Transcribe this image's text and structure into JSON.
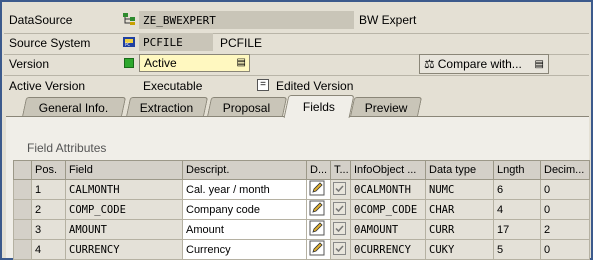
{
  "header": {
    "datasource": {
      "label": "DataSource",
      "value": "ZE_BWEXPERT",
      "description": "BW Expert"
    },
    "source_system": {
      "label": "Source System",
      "value": "PCFILE",
      "description": "PCFILE"
    },
    "version": {
      "label": "Version",
      "value": "Active"
    },
    "active_version": {
      "label": "Active Version",
      "value": "Executable",
      "edited_label": "Edited Version"
    },
    "compare_button": {
      "label": "Compare with..."
    }
  },
  "tabs": [
    {
      "label": "General Info."
    },
    {
      "label": "Extraction"
    },
    {
      "label": "Proposal"
    },
    {
      "label": "Fields",
      "active": true
    },
    {
      "label": "Preview"
    }
  ],
  "field_attributes": {
    "title": "Field Attributes",
    "columns": [
      "Pos.",
      "Field",
      "Descript.",
      "D...",
      "T...",
      "InfoObject ...",
      "Data type",
      "Lngth",
      "Decim..."
    ],
    "rows": [
      {
        "pos": "1",
        "field": "CALMONTH",
        "descript": "Cal. year / month",
        "infoobject": "0CALMONTH",
        "datatype": "NUMC",
        "length": "6",
        "decimals": "0"
      },
      {
        "pos": "2",
        "field": "COMP_CODE",
        "descript": "Company code",
        "infoobject": "0COMP_CODE",
        "datatype": "CHAR",
        "length": "4",
        "decimals": "0"
      },
      {
        "pos": "3",
        "field": "AMOUNT",
        "descript": "Amount",
        "infoobject": "0AMOUNT",
        "datatype": "CURR",
        "length": "17",
        "decimals": "2"
      },
      {
        "pos": "4",
        "field": "CURRENCY",
        "descript": "Currency",
        "infoobject": "0CURRENCY",
        "datatype": "CUKY",
        "length": "5",
        "decimals": "0"
      }
    ]
  },
  "colors": {
    "frame": "#3c5a8c",
    "version_field": "#fff8c0",
    "status_green": "#2ea82e",
    "field_bg": "#c9c5b8"
  }
}
